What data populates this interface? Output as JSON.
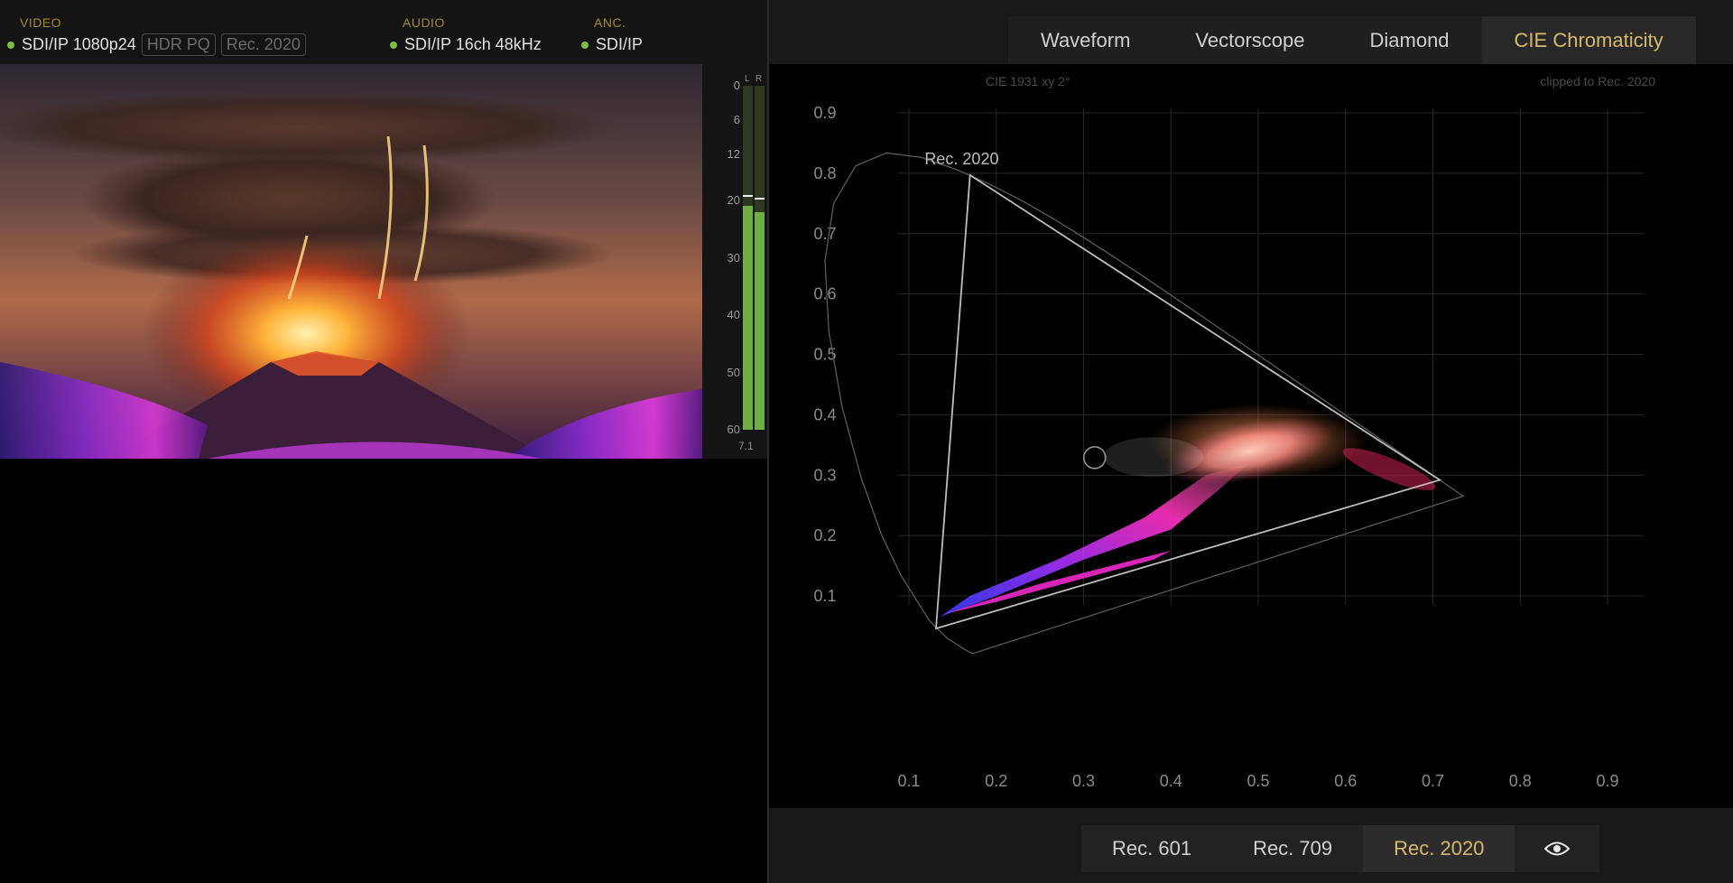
{
  "status": {
    "video": {
      "label": "VIDEO",
      "value": "SDI/IP 1080p24",
      "tags": [
        "HDR PQ",
        "Rec. 2020"
      ]
    },
    "audio": {
      "label": "AUDIO",
      "value": "SDI/IP 16ch 48kHz"
    },
    "anc": {
      "label": "ANC.",
      "value": "SDI/IP"
    },
    "ok_color": "#7ac043"
  },
  "meter": {
    "channels": [
      "L",
      "R"
    ],
    "ticks": [
      "0",
      "6",
      "12",
      "20",
      "30",
      "40",
      "50",
      "60"
    ],
    "levels": {
      "L": -21,
      "R": -22
    },
    "peaks": {
      "L": -19,
      "R": -19.5
    },
    "format": "7.1"
  },
  "scope_tabs": [
    {
      "label": "Waveform",
      "active": false
    },
    {
      "label": "Vectorscope",
      "active": false
    },
    {
      "label": "Diamond",
      "active": false
    },
    {
      "label": "CIE Chromaticity",
      "active": true
    }
  ],
  "plot": {
    "title_left": "CIE 1931 xy 2°",
    "title_right": "clipped to Rec. 2020",
    "gamut_label": "Rec. 2020",
    "x_ticks": [
      "0.1",
      "0.2",
      "0.3",
      "0.4",
      "0.5",
      "0.6",
      "0.7",
      "0.8",
      "0.9"
    ],
    "y_ticks": [
      "0.9",
      "0.8",
      "0.7",
      "0.6",
      "0.5",
      "0.4",
      "0.3",
      "0.2",
      "0.1"
    ],
    "x_range": [
      0.075,
      0.95
    ],
    "y_range": [
      0.04,
      0.95
    ]
  },
  "gamut_tabs": [
    {
      "label": "Rec. 601",
      "active": false
    },
    {
      "label": "Rec. 709",
      "active": false
    },
    {
      "label": "Rec. 2020",
      "active": true
    }
  ],
  "eye_icon": "eye-icon",
  "accent": "#d6b96a"
}
